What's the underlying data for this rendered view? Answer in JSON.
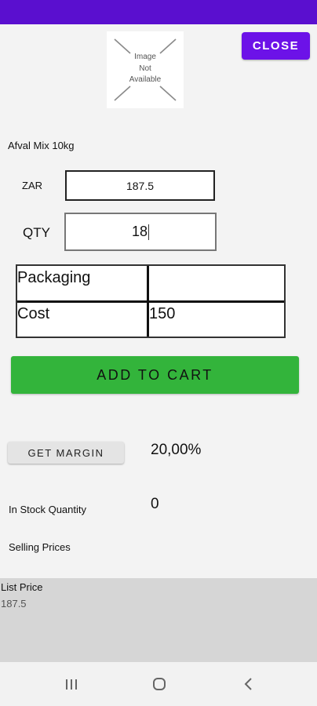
{
  "colors": {
    "status_bar": "#5a0fcf",
    "close_button": "#6c12e8",
    "add_to_cart": "#33b43b"
  },
  "product": {
    "image_placeholder": "Image\nNot\nAvailable",
    "name": "Afval Mix 10kg"
  },
  "header": {
    "close_label": "CLOSE"
  },
  "pricing": {
    "currency_label": "ZAR",
    "price_value": "187.5",
    "qty_label": "QTY",
    "qty_value": "18"
  },
  "table": {
    "rows": [
      {
        "label": "Packaging",
        "value": ""
      },
      {
        "label": "Cost",
        "value": "150"
      }
    ]
  },
  "actions": {
    "add_to_cart_label": "ADD TO CART",
    "get_margin_label": "GET MARGIN"
  },
  "margin": {
    "value": "20,00%"
  },
  "stock": {
    "label": "In Stock Quantity",
    "value": "0"
  },
  "selling": {
    "label": "Selling Prices",
    "list_price_label": "List Price",
    "list_price_value": "187.5"
  },
  "nav": {
    "icons": [
      "recent-apps-icon",
      "home-icon",
      "back-icon"
    ]
  }
}
